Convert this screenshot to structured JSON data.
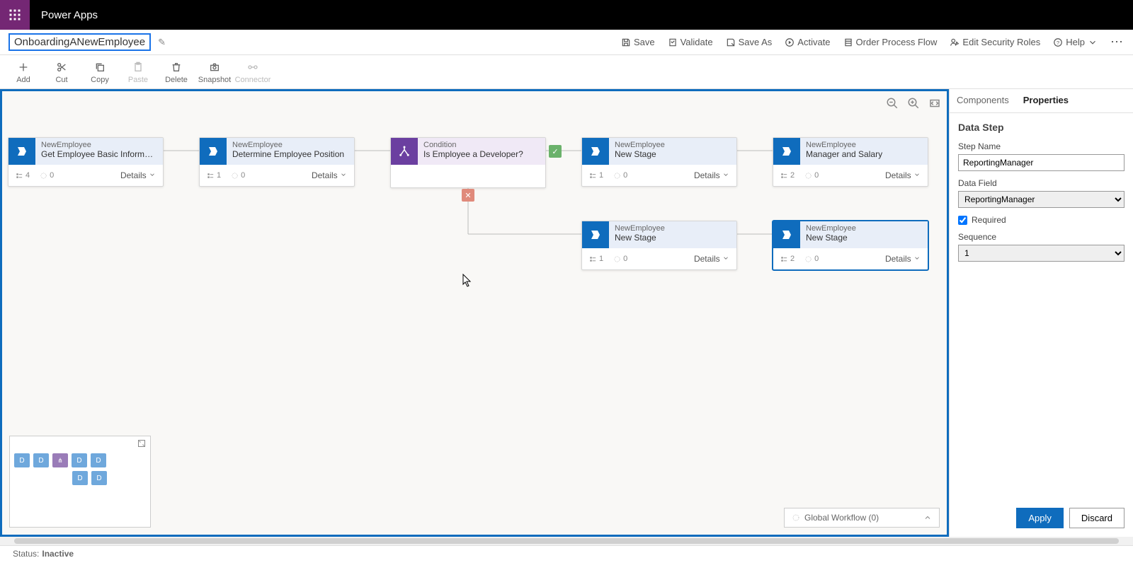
{
  "app": {
    "title": "Power Apps"
  },
  "flow": {
    "name": "OnboardingANewEmployee"
  },
  "commands": {
    "save": "Save",
    "validate": "Validate",
    "saveAs": "Save As",
    "activate": "Activate",
    "order": "Order Process Flow",
    "editRoles": "Edit Security Roles",
    "help": "Help"
  },
  "toolbar": {
    "add": "Add",
    "cut": "Cut",
    "copy": "Copy",
    "paste": "Paste",
    "delete": "Delete",
    "snapshot": "Snapshot",
    "connector": "Connector"
  },
  "nodes": {
    "n1": {
      "entity": "NewEmployee",
      "title": "Get Employee Basic Information",
      "steps": "4",
      "triggers": "0",
      "details": "Details"
    },
    "n2": {
      "entity": "NewEmployee",
      "title": "Determine Employee Position",
      "steps": "1",
      "triggers": "0",
      "details": "Details"
    },
    "n3": {
      "entity": "Condition",
      "title": "Is Employee a Developer?"
    },
    "n4": {
      "entity": "NewEmployee",
      "title": "New Stage",
      "steps": "1",
      "triggers": "0",
      "details": "Details"
    },
    "n5": {
      "entity": "NewEmployee",
      "title": "Manager and Salary",
      "steps": "2",
      "triggers": "0",
      "details": "Details"
    },
    "n6": {
      "entity": "NewEmployee",
      "title": "New Stage",
      "steps": "1",
      "triggers": "0",
      "details": "Details"
    },
    "n7": {
      "entity": "NewEmployee",
      "title": "New Stage",
      "steps": "2",
      "triggers": "0",
      "details": "Details"
    }
  },
  "rightPanel": {
    "tab1": "Components",
    "tab2": "Properties",
    "heading": "Data Step",
    "stepNameLabel": "Step Name",
    "stepName": "ReportingManager",
    "dataFieldLabel": "Data Field",
    "dataField": "ReportingManager",
    "requiredLabel": "Required",
    "requiredChecked": true,
    "sequenceLabel": "Sequence",
    "sequence": "1",
    "apply": "Apply",
    "discard": "Discard"
  },
  "globalWorkflow": "Global Workflow (0)",
  "status": {
    "label": "Status:",
    "value": "Inactive"
  },
  "minimap": {
    "D": "D",
    "A": "⋔"
  }
}
